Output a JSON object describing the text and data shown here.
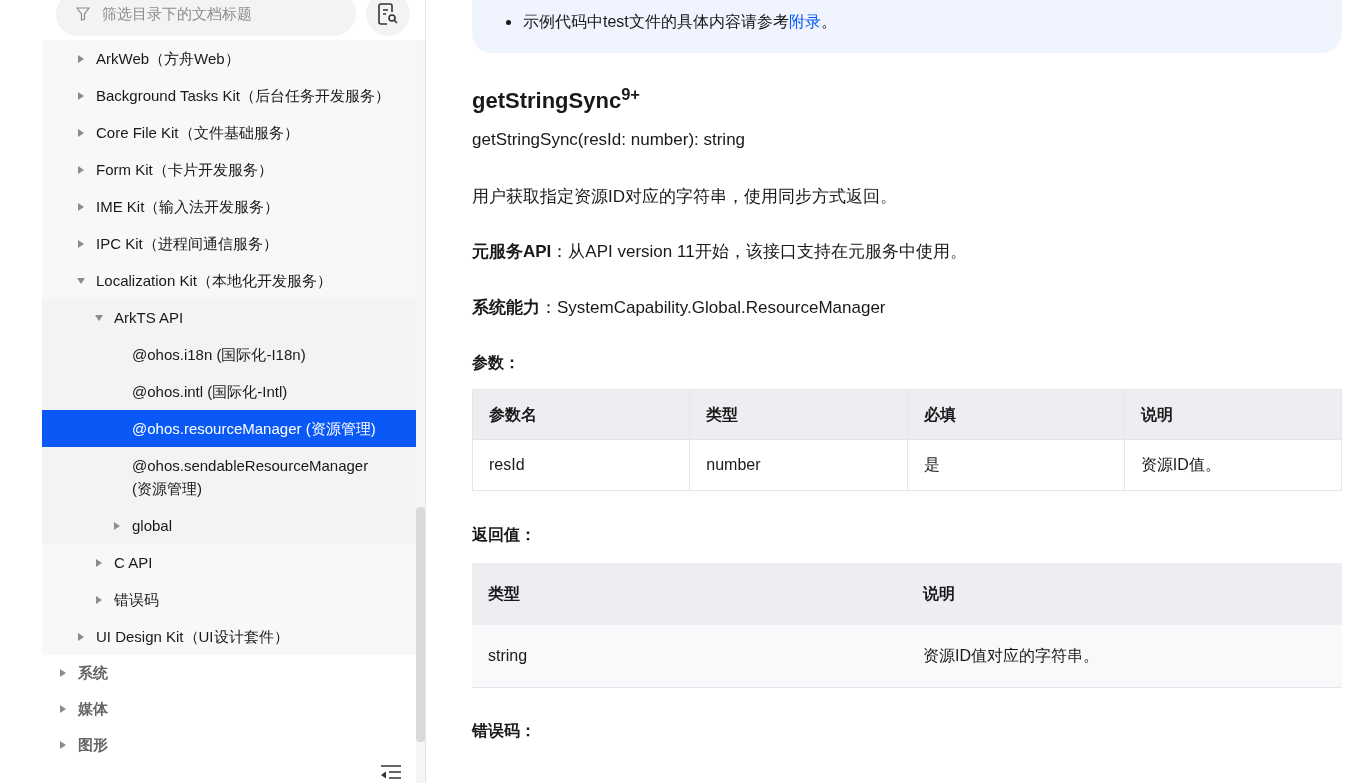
{
  "sidebar": {
    "filter": {
      "placeholder": "筛选目录下的文档标题"
    },
    "subsystem_items": [
      {
        "label": "ArkWeb（方舟Web）",
        "expanded": false,
        "selected": false
      },
      {
        "label": "Background Tasks Kit（后台任务开发服务）",
        "expanded": false,
        "selected": false
      },
      {
        "label": "Core File Kit（文件基础服务）",
        "expanded": false,
        "selected": false
      },
      {
        "label": "Form Kit（卡片开发服务）",
        "expanded": false,
        "selected": false
      },
      {
        "label": "IME Kit（输入法开发服务）",
        "expanded": false,
        "selected": false
      },
      {
        "label": "IPC Kit（进程间通信服务）",
        "expanded": false,
        "selected": false
      },
      {
        "label": "Localization Kit（本地化开发服务）",
        "expanded": true,
        "selected": false,
        "children": [
          {
            "label": "ArkTS API",
            "expanded": true,
            "selected": false,
            "children": [
              {
                "label": "@ohos.i18n (国际化-I18n)",
                "selected": false
              },
              {
                "label": "@ohos.intl (国际化-Intl)",
                "selected": false
              },
              {
                "label": "@ohos.resourceManager (资源管理)",
                "selected": true
              },
              {
                "label": "@ohos.sendableResourceManager (资源管理)",
                "selected": false
              },
              {
                "label": "global",
                "expanded": false,
                "selected": false
              }
            ]
          },
          {
            "label": "C API",
            "expanded": false,
            "selected": false
          },
          {
            "label": "错误码",
            "expanded": false,
            "selected": false
          }
        ]
      },
      {
        "label": "UI Design Kit（UI设计套件）",
        "expanded": false,
        "selected": false
      }
    ],
    "sections": [
      {
        "label": "系统",
        "expanded": false,
        "selected": false
      },
      {
        "label": "媒体",
        "expanded": false,
        "selected": false
      },
      {
        "label": "图形",
        "expanded": false,
        "selected": false
      }
    ]
  },
  "content": {
    "note": {
      "bullet": "示例代码中test文件的具体内容请参考",
      "link": "附录",
      "end": "。"
    },
    "title": "getStringSync$^{9+}$",
    "signature": "getStringSync(resId: number): string",
    "description": "用户获取指定资源ID对应的字符串，使用同步方式返回。",
    "atomic_api": "**元服务API**：从API version 11开始，该接口支持在元服务中使用。",
    "capability": "**系统能力**：SystemCapability.Global.ResourceManager",
    "params_heading": "参数：",
    "params_table": {
      "columns": [
        "参数名",
        "类型",
        "必填",
        "说明"
      ],
      "rows": [
        [
          "resId",
          "number",
          "是",
          "资源ID值。"
        ]
      ]
    },
    "return_heading": "返回值：",
    "return_table": {
      "columns": [
        "类型",
        "说明"
      ],
      "rows": [
        [
          "string",
          "资源ID值对应的字符串。"
        ]
      ]
    },
    "errors_heading": "错误码："
  }
}
